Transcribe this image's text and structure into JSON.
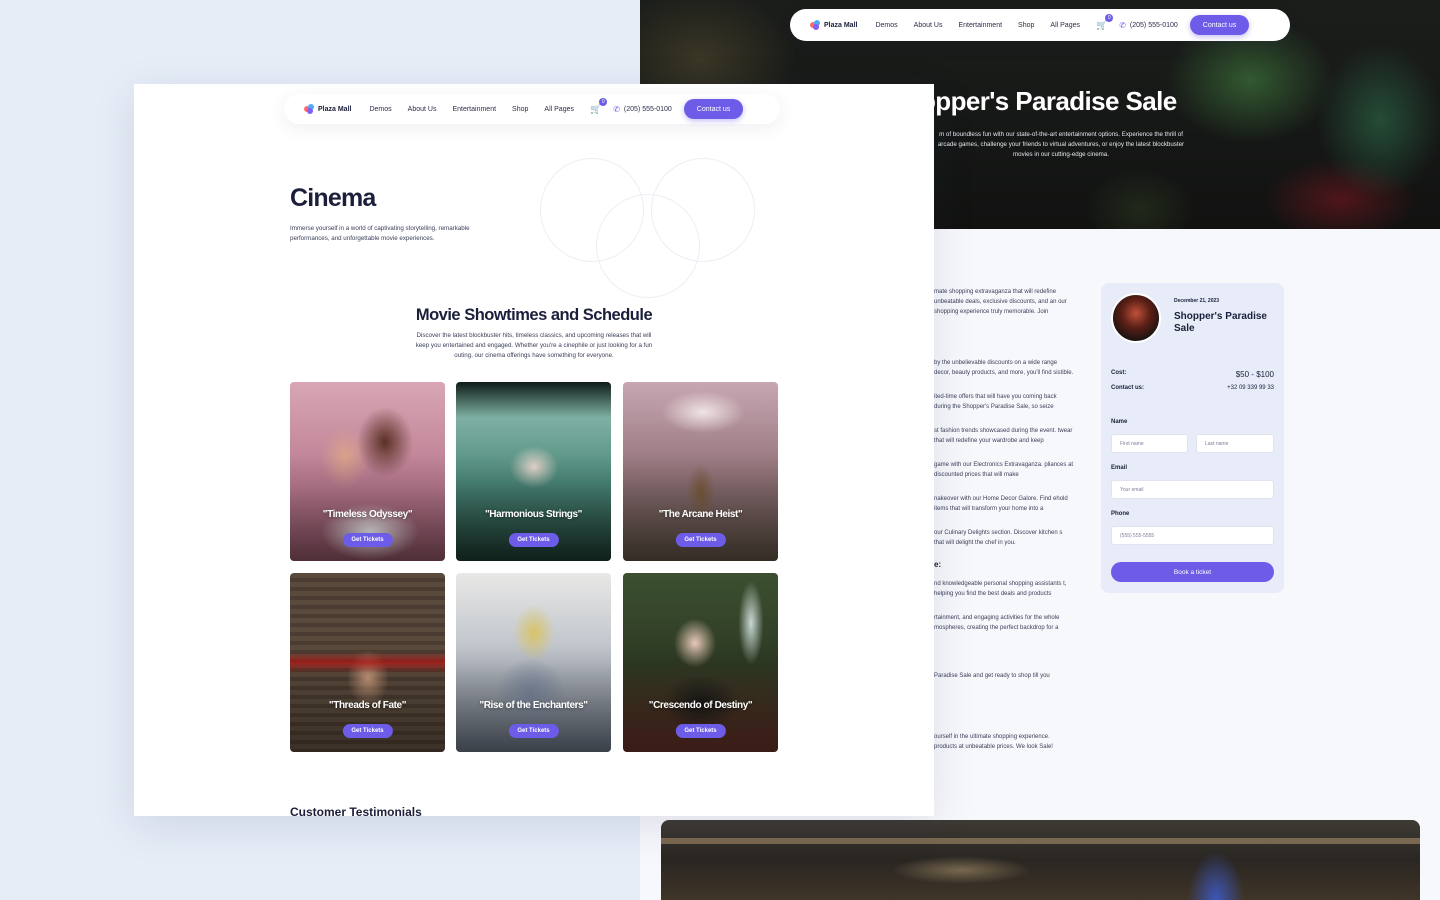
{
  "nav": {
    "brand": "Plaza Mall",
    "links": [
      "Demos",
      "About Us",
      "Entertainment",
      "Shop",
      "All Pages"
    ],
    "cart_count": "0",
    "phone": "(205) 555-0100",
    "contact_label": "Contact us"
  },
  "event_page": {
    "hero_title": "opper's Paradise Sale",
    "hero_desc": "m of boundless fun with our state-of-the-art entertainment options. Experience the thrill of arcade games, challenge your friends to virtual adventures, or enjoy the latest blockbuster movies in our cutting-edge cinema.",
    "body_text": [
      "mate shopping extravaganza that will redefine unbeatable deals, exclusive discounts, and an our shopping experience truly memorable. Join",
      "by the unbelievable discounts on a wide range decor, beauty products, and more, you'll find sistible.",
      "ited-time offers that will have you coming back during the Shopper's Paradise Sale, so seize",
      "st fashion trends showcased during the event. twear that will redefine your wardrobe and keep",
      "game with our Electronics Extravaganza. pliances at discounted prices that will make",
      "nakeover with our Home Decor Galore. Find ehold items that will transform your home into a",
      "our Culinary Delights section. Discover kitchen s that will delight the chef in you.",
      "nd knowledgeable personal shopping assistants t, helping you find the best deals and products",
      "rtainment, and engaging activities for the whole mospheres, creating the perfect backdrop for a",
      "Paradise Sale and get ready to shop till you",
      "ourself in the ultimate shopping experience. products at unbeatable prices. We look Sale!"
    ],
    "body_heading": "e:",
    "booking": {
      "date": "December 21, 2023",
      "title": "Shopper's Paradise Sale",
      "cost_label": "Cost:",
      "cost_value": "$50 - $100",
      "contact_label": "Contact us:",
      "contact_value": "+32 09 339 99 33",
      "name_label": "Name",
      "first_name_placeholder": "First name",
      "last_name_placeholder": "Last name",
      "email_label": "Email",
      "email_placeholder": "Your email",
      "phone_label": "Phone",
      "phone_placeholder": "(555) 555-5555",
      "submit_label": "Book a ticket"
    }
  },
  "cinema_page": {
    "title": "Cinema",
    "subtitle": "Immerse yourself in a world of captivating storytelling, remarkable performances, and unforgettable movie experiences.",
    "section_title": "Movie Showtimes and Schedule",
    "section_sub": "Discover the latest blockbuster hits, timeless classics, and upcoming releases that will keep you entertained and engaged. Whether you're a cinephile or just looking for a fun outing, our cinema offerings have something for everyone.",
    "ticket_label": "Get Tickets",
    "movies": [
      {
        "title": "\"Timeless Odyssey\""
      },
      {
        "title": "\"Harmonious Strings\""
      },
      {
        "title": "\"The Arcane Heist\""
      },
      {
        "title": "\"Threads of Fate\""
      },
      {
        "title": "\"Rise of the Enchanters\""
      },
      {
        "title": "\"Crescendo of Destiny\""
      }
    ],
    "testimonials_title": "Customer Testimonials"
  },
  "colors": {
    "accent": "#6c5ce7",
    "page_bg": "#e6edf7",
    "text_dark": "#1b1f3b"
  }
}
